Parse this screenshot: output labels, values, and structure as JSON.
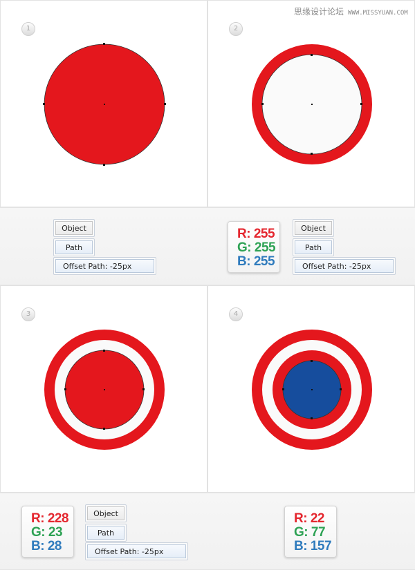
{
  "watermark": {
    "cn": "思缘设计论坛",
    "url": "WWW.MISSYUAN.COM"
  },
  "colors": {
    "red": "#e4171d",
    "white": "#fafafa",
    "blue": "#164d9d"
  },
  "steps": [
    "1",
    "2",
    "3",
    "4"
  ],
  "strip1": {
    "left": {
      "object": "Object",
      "path": "Path",
      "offset": "Offset Path: -25px"
    },
    "rgb": {
      "r": "R: 255",
      "g": "G: 255",
      "b": "B: 255"
    },
    "right": {
      "object": "Object",
      "path": "Path",
      "offset": "Offset Path: -25px"
    }
  },
  "strip2": {
    "rgb1": {
      "r": "R: 228",
      "g": "G: 23",
      "b": "B: 28"
    },
    "buttons": {
      "object": "Object",
      "path": "Path",
      "offset": "Offset Path: -25px"
    },
    "rgb2": {
      "r": "R: 22",
      "g": "G: 77",
      "b": "B: 157"
    }
  }
}
